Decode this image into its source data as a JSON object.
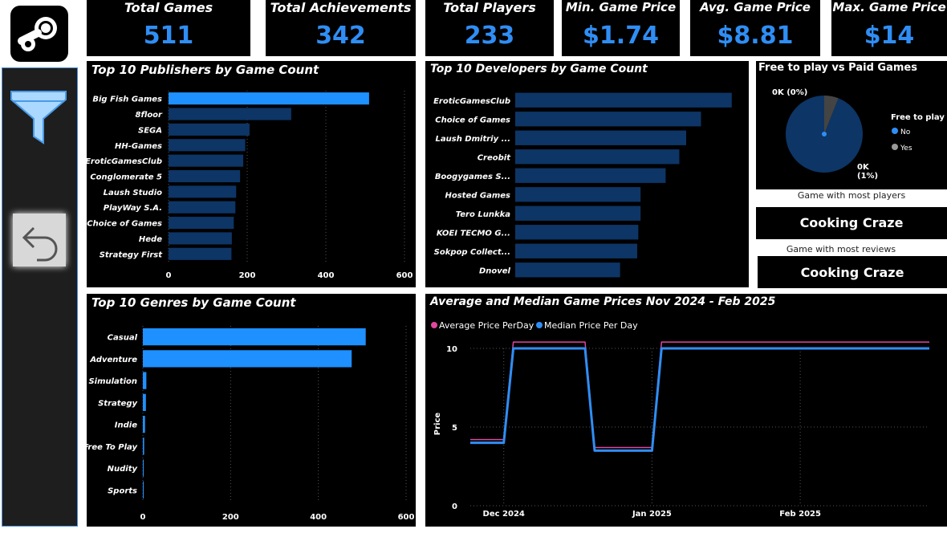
{
  "kpis": {
    "total_games": {
      "label": "Total Games",
      "value": "511"
    },
    "total_achievements": {
      "label": "Total Achievements",
      "value": "342"
    },
    "total_players": {
      "label": "Total Players",
      "value": "233"
    },
    "min_price": {
      "label": "Min. Game Price",
      "value": "$1.74"
    },
    "avg_price": {
      "label": "Avg. Game Price",
      "value": "$8.81"
    },
    "max_price": {
      "label": "Max. Game Price",
      "value": "$14"
    }
  },
  "sidebar": {
    "logo_icon": "steam-logo-icon",
    "filter_icon": "filter-funnel-icon",
    "back_icon": "back-arrow-icon"
  },
  "colors": {
    "accent": "#2f8ef5",
    "bar_dark": "#0d3566",
    "bar_bright": "#1e90ff",
    "avg_line": "#e0479e",
    "median_line": "#2f8ef5",
    "pie_no": "#0d3566",
    "pie_yes": "#444444",
    "sidebar_bg": "#1e1e1e"
  },
  "publishers": {
    "title": "Top 10 Publishers by Game Count",
    "chart_data": {
      "type": "bar",
      "orientation": "horizontal",
      "categories": [
        "Big Fish Games",
        "8floor",
        "SEGA",
        "HH-Games",
        "EroticGamesClub",
        "Conglomerate 5",
        "Laush Studio",
        "PlayWay S.A.",
        "Choice of Games",
        "Hede",
        "Strategy First"
      ],
      "values": [
        510,
        312,
        206,
        195,
        190,
        182,
        172,
        170,
        166,
        161,
        160
      ],
      "xlim": [
        0,
        600
      ],
      "xticks": [
        "0",
        "200",
        "400",
        "600"
      ]
    }
  },
  "developers": {
    "title": "Top 10 Developers by Game Count",
    "chart_data": {
      "type": "bar",
      "orientation": "horizontal",
      "categories": [
        "EroticGamesClub",
        "Choice of Games",
        "Laush Dmitriy ...",
        "Creobit",
        "Boogygames S...",
        "Hosted Games",
        "Tero Lunkka",
        "KOEI TECMO G...",
        "Sokpop Collect...",
        "Dnovel"
      ],
      "values": [
        190,
        163,
        150,
        144,
        132,
        110,
        110,
        108,
        107,
        92
      ],
      "xlim": [
        0,
        200
      ]
    }
  },
  "genres": {
    "title": "Top 10 Genres by Game Count",
    "chart_data": {
      "type": "bar",
      "orientation": "horizontal",
      "categories": [
        "Casual",
        "Adventure",
        "Simulation",
        "Strategy",
        "Indie",
        "Free To Play",
        "Nudity",
        "Sports"
      ],
      "values": [
        508,
        476,
        8,
        7,
        5,
        3,
        2,
        2
      ],
      "xlim": [
        0,
        600
      ],
      "xticks": [
        "0",
        "200",
        "400",
        "600"
      ]
    }
  },
  "pie": {
    "title": "Free to play vs Paid Games",
    "legend_title": "Free to play",
    "chart_data": {
      "type": "pie",
      "categories": [
        "No",
        "Yes"
      ],
      "values": [
        94,
        6
      ],
      "data_labels": [
        "0K\n(1%)",
        "0K (0%)"
      ]
    }
  },
  "most_players": {
    "caption": "Game with most players",
    "name": "Cooking Craze"
  },
  "most_reviews": {
    "caption": "Game with most reviews",
    "name": "Cooking Craze"
  },
  "prices": {
    "title": "Average and Median Game Prices Nov 2024 - Feb 2025",
    "chart_data": {
      "type": "line",
      "ylabel": "Price",
      "ylim": [
        0,
        10
      ],
      "yticks": [
        "0",
        "5",
        "10"
      ],
      "xticks": [
        "Dec 2024",
        "Jan 2025",
        "Feb 2025"
      ],
      "series": [
        {
          "name": "Average Price PerDay",
          "x": [
            "2024-11-24",
            "2024-12-01",
            "2024-12-03",
            "2024-12-18",
            "2024-12-20",
            "2025-01-01",
            "2025-01-03",
            "2025-02-28"
          ],
          "y": [
            4.2,
            4.2,
            10.4,
            10.4,
            3.7,
            3.7,
            10.4,
            10.4
          ]
        },
        {
          "name": "Median Price Per Day",
          "x": [
            "2024-11-24",
            "2024-12-01",
            "2024-12-03",
            "2024-12-18",
            "2024-12-20",
            "2025-01-01",
            "2025-01-03",
            "2025-02-28"
          ],
          "y": [
            4.0,
            4.0,
            10.0,
            10.0,
            3.5,
            3.5,
            10.0,
            10.0
          ]
        }
      ]
    }
  }
}
